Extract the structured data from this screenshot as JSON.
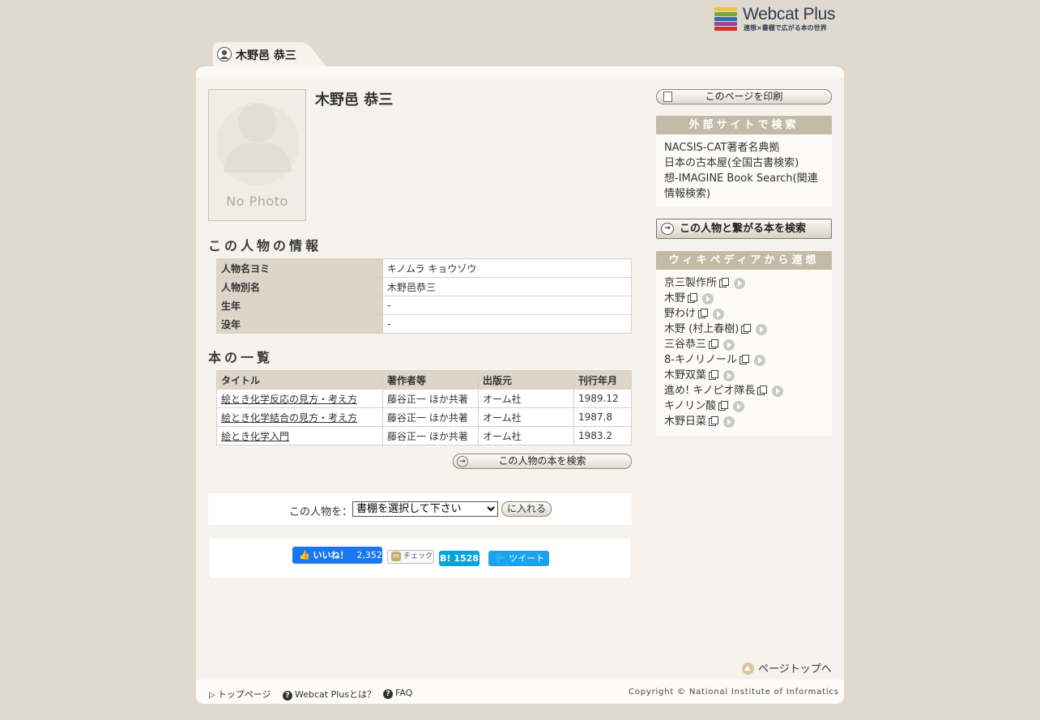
{
  "logo": {
    "brand": "Webcat Plus",
    "tagline": "連想×書棚で広がる本の世界",
    "stripe_colors": [
      "#e8c93a",
      "#7da642",
      "#2f6fb6",
      "#a0449a",
      "#c1392f"
    ]
  },
  "tab": {
    "label": "木野邑 恭三"
  },
  "person": {
    "name": "木野邑 恭三",
    "photo_placeholder": "No Photo"
  },
  "info_section": {
    "heading": "この人物の情報",
    "rows": [
      {
        "label": "人物名ヨミ",
        "value": "キノムラ キョウゾウ"
      },
      {
        "label": "人物別名",
        "value": "木野邑恭三"
      },
      {
        "label": "生年",
        "value": "-"
      },
      {
        "label": "没年",
        "value": "-"
      }
    ]
  },
  "books_section": {
    "heading": "本の一覧",
    "columns": [
      "タイトル",
      "著作者等",
      "出版元",
      "刊行年月"
    ],
    "rows": [
      {
        "title": "絵とき化学反応の見方・考え方",
        "author": "藤谷正一 ほか共著",
        "publisher": "オーム社",
        "date": "1989.12"
      },
      {
        "title": "絵とき化学結合の見方・考え方",
        "author": "藤谷正一 ほか共著",
        "publisher": "オーム社",
        "date": "1987.8"
      },
      {
        "title": "絵とき化学入門",
        "author": "藤谷正一 ほか共著",
        "publisher": "オーム社",
        "date": "1983.2"
      }
    ],
    "search_button": "この人物の本を検索"
  },
  "shelf": {
    "label": "この人物を：",
    "select_value": "書棚を選択して下さい",
    "put_button": "に入れる"
  },
  "social": {
    "like_label": "いいね！",
    "like_count": "2,352",
    "mixi_label": "チェック",
    "hatena_count": "1528",
    "tweet_label": "ツイート"
  },
  "sidebar": {
    "print_button": "このページを印刷",
    "external": {
      "heading": "外部サイトで検索",
      "links": [
        "NACSIS-CAT著者名典拠",
        "日本の古本屋(全国古書検索)",
        "想-IMAGINE Book Search(関連情報検索)"
      ]
    },
    "connect_button": "この人物と繋がる本を検索",
    "wiki": {
      "heading": "ウィキペディアから連想",
      "items": [
        "京三製作所",
        "木野",
        "野わけ",
        "木野 (村上春樹)",
        "三谷恭三",
        "8-キノリノール",
        "木野双葉",
        "進め! キノピオ隊長",
        "キノリン酸",
        "木野日菜"
      ]
    }
  },
  "pagetop": "ページトップへ",
  "footer": {
    "links": [
      "トップページ",
      "Webcat Plusとは？",
      "FAQ"
    ],
    "copyright": "Copyright © National Institute of Informatics"
  }
}
